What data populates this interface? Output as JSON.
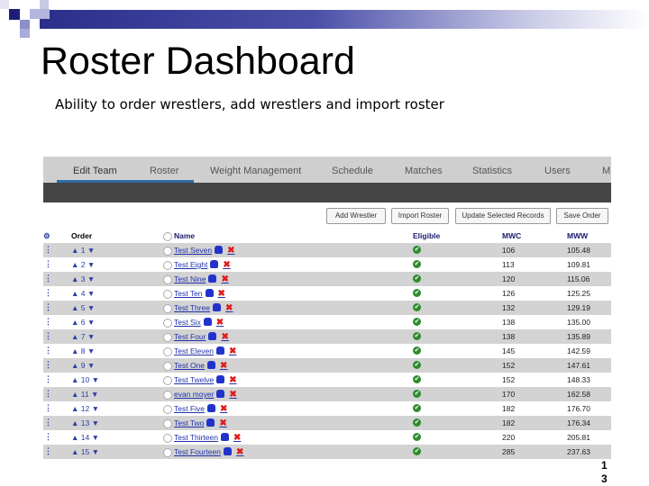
{
  "slide": {
    "title": "Roster Dashboard",
    "subtitle": "Ability to order wrestlers, add wrestlers and import roster",
    "page_number_line1": "1",
    "page_number_line2": "3"
  },
  "nav": {
    "tabs": [
      "Edit Team",
      "Roster",
      "Weight Management",
      "Schedule",
      "Matches",
      "Statistics",
      "Users",
      "M"
    ]
  },
  "toolbar": {
    "add": "Add Wrestler",
    "import": "Import Roster",
    "update": "Update Selected Records",
    "save": "Save Order"
  },
  "table": {
    "headers": {
      "handle": "⚙",
      "order": "Order",
      "name": "Name",
      "eligible": "Eligible",
      "mwc": "MWC",
      "mww": "MWW"
    },
    "rows": [
      {
        "order": "1",
        "name": "Test Seven",
        "mwc": "106",
        "mww": "105.48"
      },
      {
        "order": "2",
        "name": "Test Eight",
        "mwc": "113",
        "mww": "109.81"
      },
      {
        "order": "3",
        "name": "Test Nine",
        "mwc": "120",
        "mww": "115.06"
      },
      {
        "order": "4",
        "name": "Test Ten",
        "mwc": "126",
        "mww": "125.25"
      },
      {
        "order": "5",
        "name": "Test Three",
        "mwc": "132",
        "mww": "129.19"
      },
      {
        "order": "6",
        "name": "Test Six",
        "mwc": "138",
        "mww": "135.00"
      },
      {
        "order": "7",
        "name": "Test Four",
        "mwc": "138",
        "mww": "135.89"
      },
      {
        "order": "8",
        "name": "Test Eleven",
        "mwc": "145",
        "mww": "142.59"
      },
      {
        "order": "9",
        "name": "Test One",
        "mwc": "152",
        "mww": "147.61"
      },
      {
        "order": "10",
        "name": "Test Twelve",
        "mwc": "152",
        "mww": "148.33"
      },
      {
        "order": "11",
        "name": "evan moyer",
        "mwc": "170",
        "mww": "162.58"
      },
      {
        "order": "12",
        "name": "Test Five",
        "mwc": "182",
        "mww": "176.70"
      },
      {
        "order": "13",
        "name": "Test Two",
        "mwc": "182",
        "mww": "176.34"
      },
      {
        "order": "14",
        "name": "Test Thirteen",
        "mwc": "220",
        "mww": "205.81"
      },
      {
        "order": "15",
        "name": "Test Fourteen",
        "mwc": "285",
        "mww": "237.63"
      }
    ]
  },
  "colors": {
    "accent": "#2233aa",
    "eligible": "#2e8b2e",
    "delete": "#e01b1b"
  }
}
